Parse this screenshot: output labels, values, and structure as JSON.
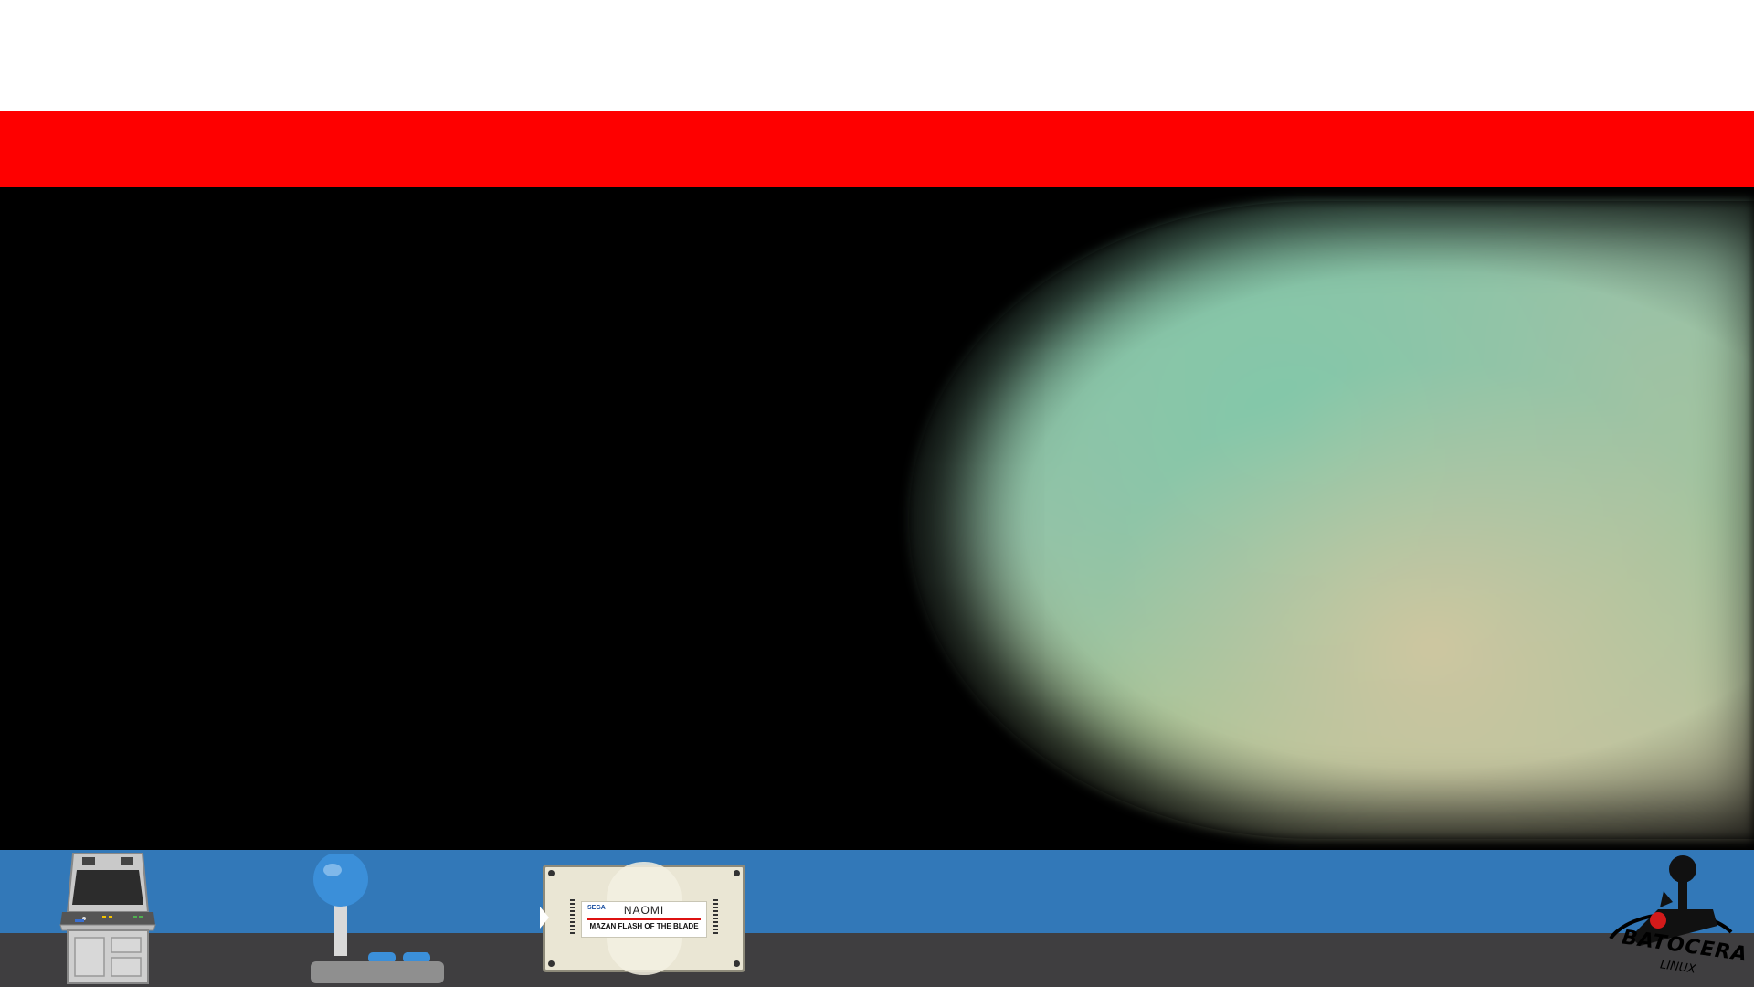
{
  "theme": {
    "top_color": "#ffffff",
    "header_color": "#fe0000",
    "main_color": "#000000",
    "footer_blue": "#3278b8",
    "footer_gray": "#3f3e40"
  },
  "footer": {
    "icons": [
      "arcade-cabinet-icon",
      "arcade-joystick-icon",
      "game-cartridge-icon",
      "batocera-logo-icon"
    ],
    "cartridge": {
      "brand": "SEGA",
      "system": "NAOMI",
      "title": "MAZAN FLASH OF THE BLADE"
    },
    "logo": {
      "name": "BATOCERA",
      "sub": "LINUX"
    }
  }
}
